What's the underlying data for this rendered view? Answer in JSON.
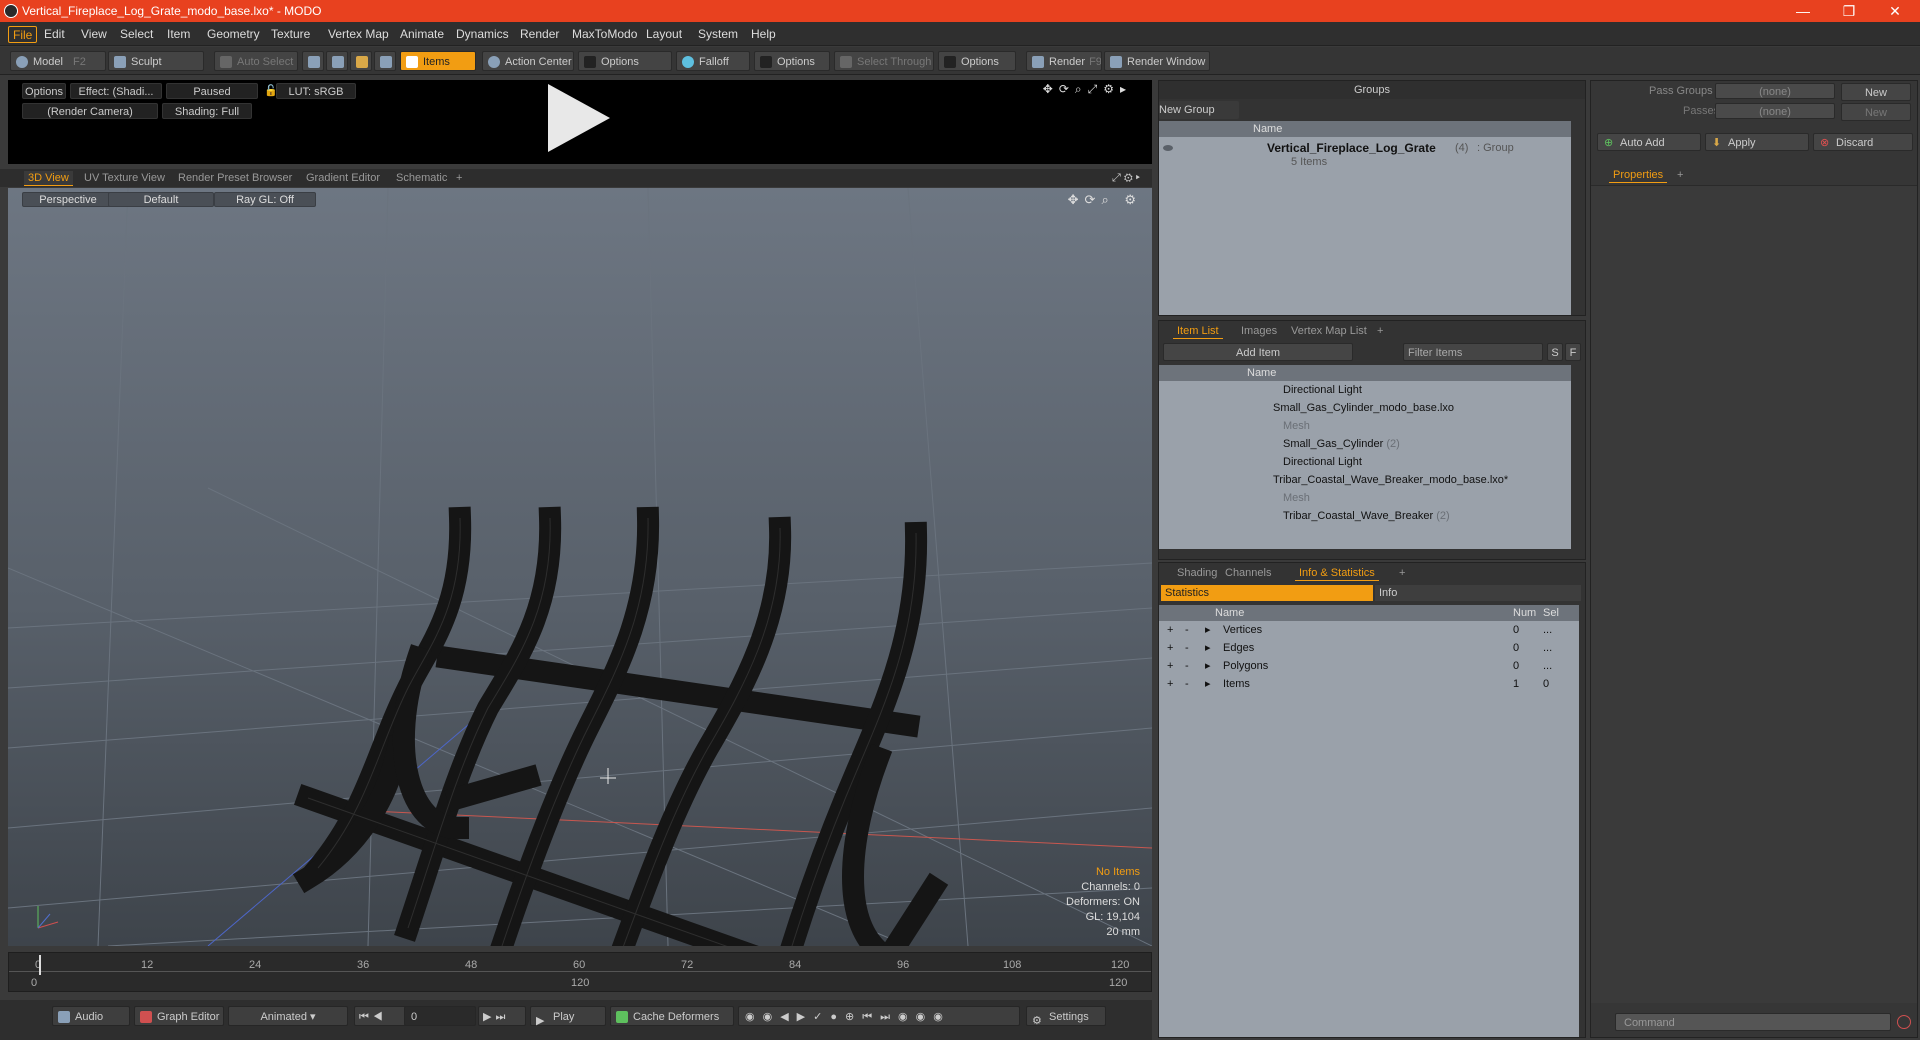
{
  "window": {
    "title": "Vertical_Fireplace_Log_Grate_modo_base.lxo* - MODO",
    "minimize": "—",
    "restore": "❐",
    "close": "✕"
  },
  "menu": [
    "File",
    "Edit",
    "View",
    "Select",
    "Item",
    "Geometry",
    "Texture",
    "Vertex Map",
    "Animate",
    "Dynamics",
    "Render",
    "MaxToModo",
    "Layout",
    "System",
    "Help"
  ],
  "toolbar": {
    "model": "Model",
    "model_key": "F2",
    "sculpt": "Sculpt",
    "auto_select": "Auto Select",
    "items": "Items",
    "action_center": "Action Center",
    "options1": "Options",
    "falloff": "Falloff",
    "options2": "Options",
    "select_through": "Select Through",
    "options3": "Options",
    "render": "Render",
    "render_key": "F9",
    "render_window": "Render Window"
  },
  "preview": {
    "options": "Options",
    "effect": "Effect: (Shadi...",
    "paused": "Paused",
    "lut": "LUT: sRGB",
    "camera": "(Render Camera)",
    "shading": "Shading: Full"
  },
  "viewport_tabs": [
    "3D View",
    "UV Texture View",
    "Render Preset Browser",
    "Gradient Editor",
    "Schematic",
    "+"
  ],
  "viewport": {
    "perspective": "Perspective",
    "default": "Default",
    "raygl": "Ray GL: Off"
  },
  "vp_stats": {
    "no_items": "No Items",
    "channels": "Channels: 0",
    "deformers": "Deformers: ON",
    "gl": "GL: 19,104",
    "scale": "20 mm"
  },
  "timeline": {
    "ticks_top": [
      "0",
      "12",
      "24",
      "36",
      "48",
      "60",
      "72",
      "84",
      "96",
      "108",
      "120"
    ],
    "start": "0",
    "mid": "120",
    "end": "120"
  },
  "bottombar": {
    "audio": "Audio",
    "graph_editor": "Graph Editor",
    "animated": "Animated",
    "frame": "0",
    "play": "Play",
    "cache": "Cache Deformers",
    "settings": "Settings"
  },
  "groups": {
    "title": "Groups",
    "new_group": "New Group",
    "col_name": "Name",
    "item_name": "Vertical_Fireplace_Log_Grate",
    "item_count": "(4)",
    "item_type": ": Group",
    "item_sub": "5 Items"
  },
  "itemlist": {
    "tabs": [
      "Item List",
      "Images",
      "Vertex Map List",
      "+"
    ],
    "add_item": "Add Item",
    "filter": "Filter Items",
    "s_btn": "S",
    "f_btn": "F",
    "col_name": "Name",
    "rows": [
      {
        "label": "Directional Light",
        "extra": ""
      },
      {
        "label": "Small_Gas_Cylinder_modo_base.lxo",
        "extra": ""
      },
      {
        "label": "Mesh",
        "extra": ""
      },
      {
        "label": "Small_Gas_Cylinder",
        "extra": "(2)"
      },
      {
        "label": "Directional Light",
        "extra": ""
      },
      {
        "label": "Tribar_Coastal_Wave_Breaker_modo_base.lxo*",
        "extra": ""
      },
      {
        "label": "Mesh",
        "extra": ""
      },
      {
        "label": "Tribar_Coastal_Wave_Breaker",
        "extra": "(2)"
      }
    ]
  },
  "stats": {
    "tabs": [
      "Shading",
      "Channels",
      "Info & Statistics",
      "+"
    ],
    "subtab_stats": "Statistics",
    "subtab_info": "Info",
    "col_name": "Name",
    "col_num": "Num",
    "col_sel": "Sel",
    "rows": [
      {
        "name": "Vertices",
        "num": "0",
        "sel": "..."
      },
      {
        "name": "Edges",
        "num": "0",
        "sel": "..."
      },
      {
        "name": "Polygons",
        "num": "0",
        "sel": "..."
      },
      {
        "name": "Items",
        "num": "1",
        "sel": "0"
      }
    ]
  },
  "right": {
    "pass_groups": "Pass Groups",
    "passes": "Passes",
    "none1": "(none)",
    "none2": "(none)",
    "new1": "New",
    "new2": "New",
    "auto_add": "Auto Add",
    "apply": "Apply",
    "discard": "Discard",
    "properties": "Properties",
    "plus": "+",
    "command": "Command"
  }
}
